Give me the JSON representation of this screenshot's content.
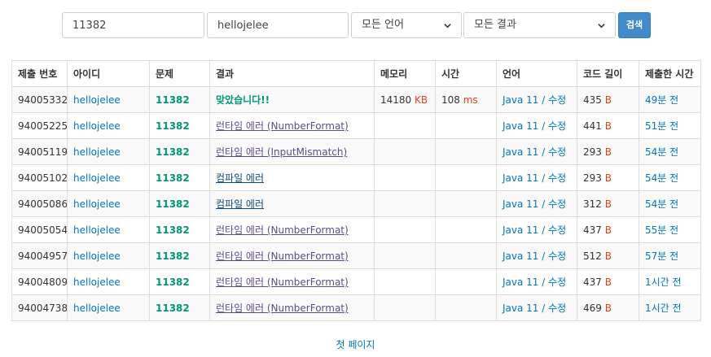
{
  "search": {
    "problem_value": "11382",
    "user_value": "hellojelee",
    "language_selected": "모든 언어",
    "result_selected": "모든 결과",
    "search_label": "검색"
  },
  "table": {
    "headers": [
      "제출 번호",
      "아이디",
      "문제",
      "결과",
      "메모리",
      "시간",
      "언어",
      "코드 길이",
      "제출한 시간"
    ],
    "memory_unit": "KB",
    "time_unit": "ms",
    "length_unit": "B",
    "rows": [
      {
        "id": "94005332",
        "user": "hellojelee",
        "problem": "11382",
        "result": "맞았습니다!!",
        "result_type": "ac",
        "memory": "14180",
        "time": "108",
        "language": "Java 11",
        "edit": "수정",
        "length": "435",
        "submitted": "49분 전"
      },
      {
        "id": "94005225",
        "user": "hellojelee",
        "problem": "11382",
        "result": "런타임 에러 (NumberFormat)",
        "result_type": "rte",
        "memory": "",
        "time": "",
        "language": "Java 11",
        "edit": "수정",
        "length": "441",
        "submitted": "51분 전"
      },
      {
        "id": "94005119",
        "user": "hellojelee",
        "problem": "11382",
        "result": "런타임 에러 (InputMismatch)",
        "result_type": "rte",
        "memory": "",
        "time": "",
        "language": "Java 11",
        "edit": "수정",
        "length": "293",
        "submitted": "54분 전"
      },
      {
        "id": "94005102",
        "user": "hellojelee",
        "problem": "11382",
        "result": "컴파일 에러",
        "result_type": "ce",
        "memory": "",
        "time": "",
        "language": "Java 11",
        "edit": "수정",
        "length": "293",
        "submitted": "54분 전"
      },
      {
        "id": "94005086",
        "user": "hellojelee",
        "problem": "11382",
        "result": "컴파일 에러",
        "result_type": "ce",
        "memory": "",
        "time": "",
        "language": "Java 11",
        "edit": "수정",
        "length": "312",
        "submitted": "54분 전"
      },
      {
        "id": "94005054",
        "user": "hellojelee",
        "problem": "11382",
        "result": "런타임 에러 (NumberFormat)",
        "result_type": "rte",
        "memory": "",
        "time": "",
        "language": "Java 11",
        "edit": "수정",
        "length": "437",
        "submitted": "55분 전"
      },
      {
        "id": "94004957",
        "user": "hellojelee",
        "problem": "11382",
        "result": "런타임 에러 (NumberFormat)",
        "result_type": "rte",
        "memory": "",
        "time": "",
        "language": "Java 11",
        "edit": "수정",
        "length": "512",
        "submitted": "57분 전"
      },
      {
        "id": "94004809",
        "user": "hellojelee",
        "problem": "11382",
        "result": "런타임 에러 (NumberFormat)",
        "result_type": "rte",
        "memory": "",
        "time": "",
        "language": "Java 11",
        "edit": "수정",
        "length": "437",
        "submitted": "1시간 전"
      },
      {
        "id": "94004738",
        "user": "hellojelee",
        "problem": "11382",
        "result": "런타임 에러 (NumberFormat)",
        "result_type": "rte",
        "memory": "",
        "time": "",
        "language": "Java 11",
        "edit": "수정",
        "length": "469",
        "submitted": "1시간 전"
      }
    ]
  },
  "pagination": {
    "first_page_label": "첫 페이지"
  },
  "icons": {
    "select_arrow": "chevron-down-icon"
  },
  "colors": {
    "link": "#0076c0",
    "accepted": "#009874",
    "runtime_error": "#5f4b8b",
    "compile_error": "#0f4c81",
    "unit": "#dd4124",
    "button": "#428bca"
  }
}
